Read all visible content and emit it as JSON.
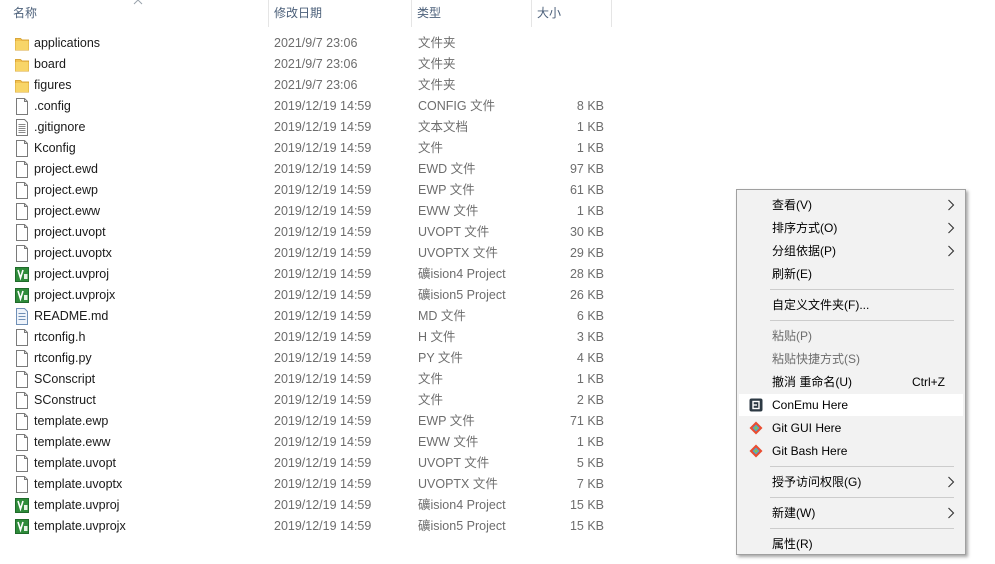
{
  "columns": {
    "name": "名称",
    "date": "修改日期",
    "type": "类型",
    "size": "大小"
  },
  "files": [
    {
      "name": "applications",
      "date": "2021/9/7 23:06",
      "type": "文件夹",
      "size": "",
      "icon": "folder-icon"
    },
    {
      "name": "board",
      "date": "2021/9/7 23:06",
      "type": "文件夹",
      "size": "",
      "icon": "folder-icon"
    },
    {
      "name": "figures",
      "date": "2021/9/7 23:06",
      "type": "文件夹",
      "size": "",
      "icon": "folder-icon"
    },
    {
      "name": ".config",
      "date": "2019/12/19 14:59",
      "type": "CONFIG 文件",
      "size": "8 KB",
      "icon": "file-icon"
    },
    {
      "name": ".gitignore",
      "date": "2019/12/19 14:59",
      "type": "文本文档",
      "size": "1 KB",
      "icon": "text-file-icon"
    },
    {
      "name": "Kconfig",
      "date": "2019/12/19 14:59",
      "type": "文件",
      "size": "1 KB",
      "icon": "file-icon"
    },
    {
      "name": "project.ewd",
      "date": "2019/12/19 14:59",
      "type": "EWD 文件",
      "size": "97 KB",
      "icon": "file-icon"
    },
    {
      "name": "project.ewp",
      "date": "2019/12/19 14:59",
      "type": "EWP 文件",
      "size": "61 KB",
      "icon": "file-icon"
    },
    {
      "name": "project.eww",
      "date": "2019/12/19 14:59",
      "type": "EWW 文件",
      "size": "1 KB",
      "icon": "file-icon"
    },
    {
      "name": "project.uvopt",
      "date": "2019/12/19 14:59",
      "type": "UVOPT 文件",
      "size": "30 KB",
      "icon": "file-icon"
    },
    {
      "name": "project.uvoptx",
      "date": "2019/12/19 14:59",
      "type": "UVOPTX 文件",
      "size": "29 KB",
      "icon": "file-icon"
    },
    {
      "name": "project.uvproj",
      "date": "2019/12/19 14:59",
      "type": "礦ision4 Project",
      "size": "28 KB",
      "icon": "keil-project-icon"
    },
    {
      "name": "project.uvprojx",
      "date": "2019/12/19 14:59",
      "type": "礦ision5 Project",
      "size": "26 KB",
      "icon": "keil-project-icon"
    },
    {
      "name": "README.md",
      "date": "2019/12/19 14:59",
      "type": "MD 文件",
      "size": "6 KB",
      "icon": "markdown-file-icon"
    },
    {
      "name": "rtconfig.h",
      "date": "2019/12/19 14:59",
      "type": "H 文件",
      "size": "3 KB",
      "icon": "file-icon"
    },
    {
      "name": "rtconfig.py",
      "date": "2019/12/19 14:59",
      "type": "PY 文件",
      "size": "4 KB",
      "icon": "file-icon"
    },
    {
      "name": "SConscript",
      "date": "2019/12/19 14:59",
      "type": "文件",
      "size": "1 KB",
      "icon": "file-icon"
    },
    {
      "name": "SConstruct",
      "date": "2019/12/19 14:59",
      "type": "文件",
      "size": "2 KB",
      "icon": "file-icon"
    },
    {
      "name": "template.ewp",
      "date": "2019/12/19 14:59",
      "type": "EWP 文件",
      "size": "71 KB",
      "icon": "file-icon"
    },
    {
      "name": "template.eww",
      "date": "2019/12/19 14:59",
      "type": "EWW 文件",
      "size": "1 KB",
      "icon": "file-icon"
    },
    {
      "name": "template.uvopt",
      "date": "2019/12/19 14:59",
      "type": "UVOPT 文件",
      "size": "5 KB",
      "icon": "file-icon"
    },
    {
      "name": "template.uvoptx",
      "date": "2019/12/19 14:59",
      "type": "UVOPTX 文件",
      "size": "7 KB",
      "icon": "file-icon"
    },
    {
      "name": "template.uvproj",
      "date": "2019/12/19 14:59",
      "type": "礦ision4 Project",
      "size": "15 KB",
      "icon": "keil-project-icon"
    },
    {
      "name": "template.uvprojx",
      "date": "2019/12/19 14:59",
      "type": "礦ision5 Project",
      "size": "15 KB",
      "icon": "keil-project-icon"
    }
  ],
  "context_menu": {
    "items": [
      {
        "type": "item",
        "label": "查看(V)",
        "submenu": true
      },
      {
        "type": "item",
        "label": "排序方式(O)",
        "submenu": true
      },
      {
        "type": "item",
        "label": "分组依据(P)",
        "submenu": true
      },
      {
        "type": "item",
        "label": "刷新(E)"
      },
      {
        "type": "separator"
      },
      {
        "type": "item",
        "label": "自定义文件夹(F)..."
      },
      {
        "type": "separator"
      },
      {
        "type": "item",
        "label": "粘贴(P)",
        "disabled": true
      },
      {
        "type": "item",
        "label": "粘贴快捷方式(S)",
        "disabled": true
      },
      {
        "type": "item",
        "label": "撤消 重命名(U)",
        "accelerator": "Ctrl+Z"
      },
      {
        "type": "item",
        "label": "ConEmu Here",
        "icon": "conemu-icon",
        "highlighted": true
      },
      {
        "type": "item",
        "label": "Git GUI Here",
        "icon": "git-gui-icon"
      },
      {
        "type": "item",
        "label": "Git Bash Here",
        "icon": "git-bash-icon"
      },
      {
        "type": "separator"
      },
      {
        "type": "item",
        "label": "授予访问权限(G)",
        "submenu": true
      },
      {
        "type": "separator"
      },
      {
        "type": "item",
        "label": "新建(W)",
        "submenu": true
      },
      {
        "type": "separator"
      },
      {
        "type": "item",
        "label": "属性(R)"
      }
    ]
  }
}
